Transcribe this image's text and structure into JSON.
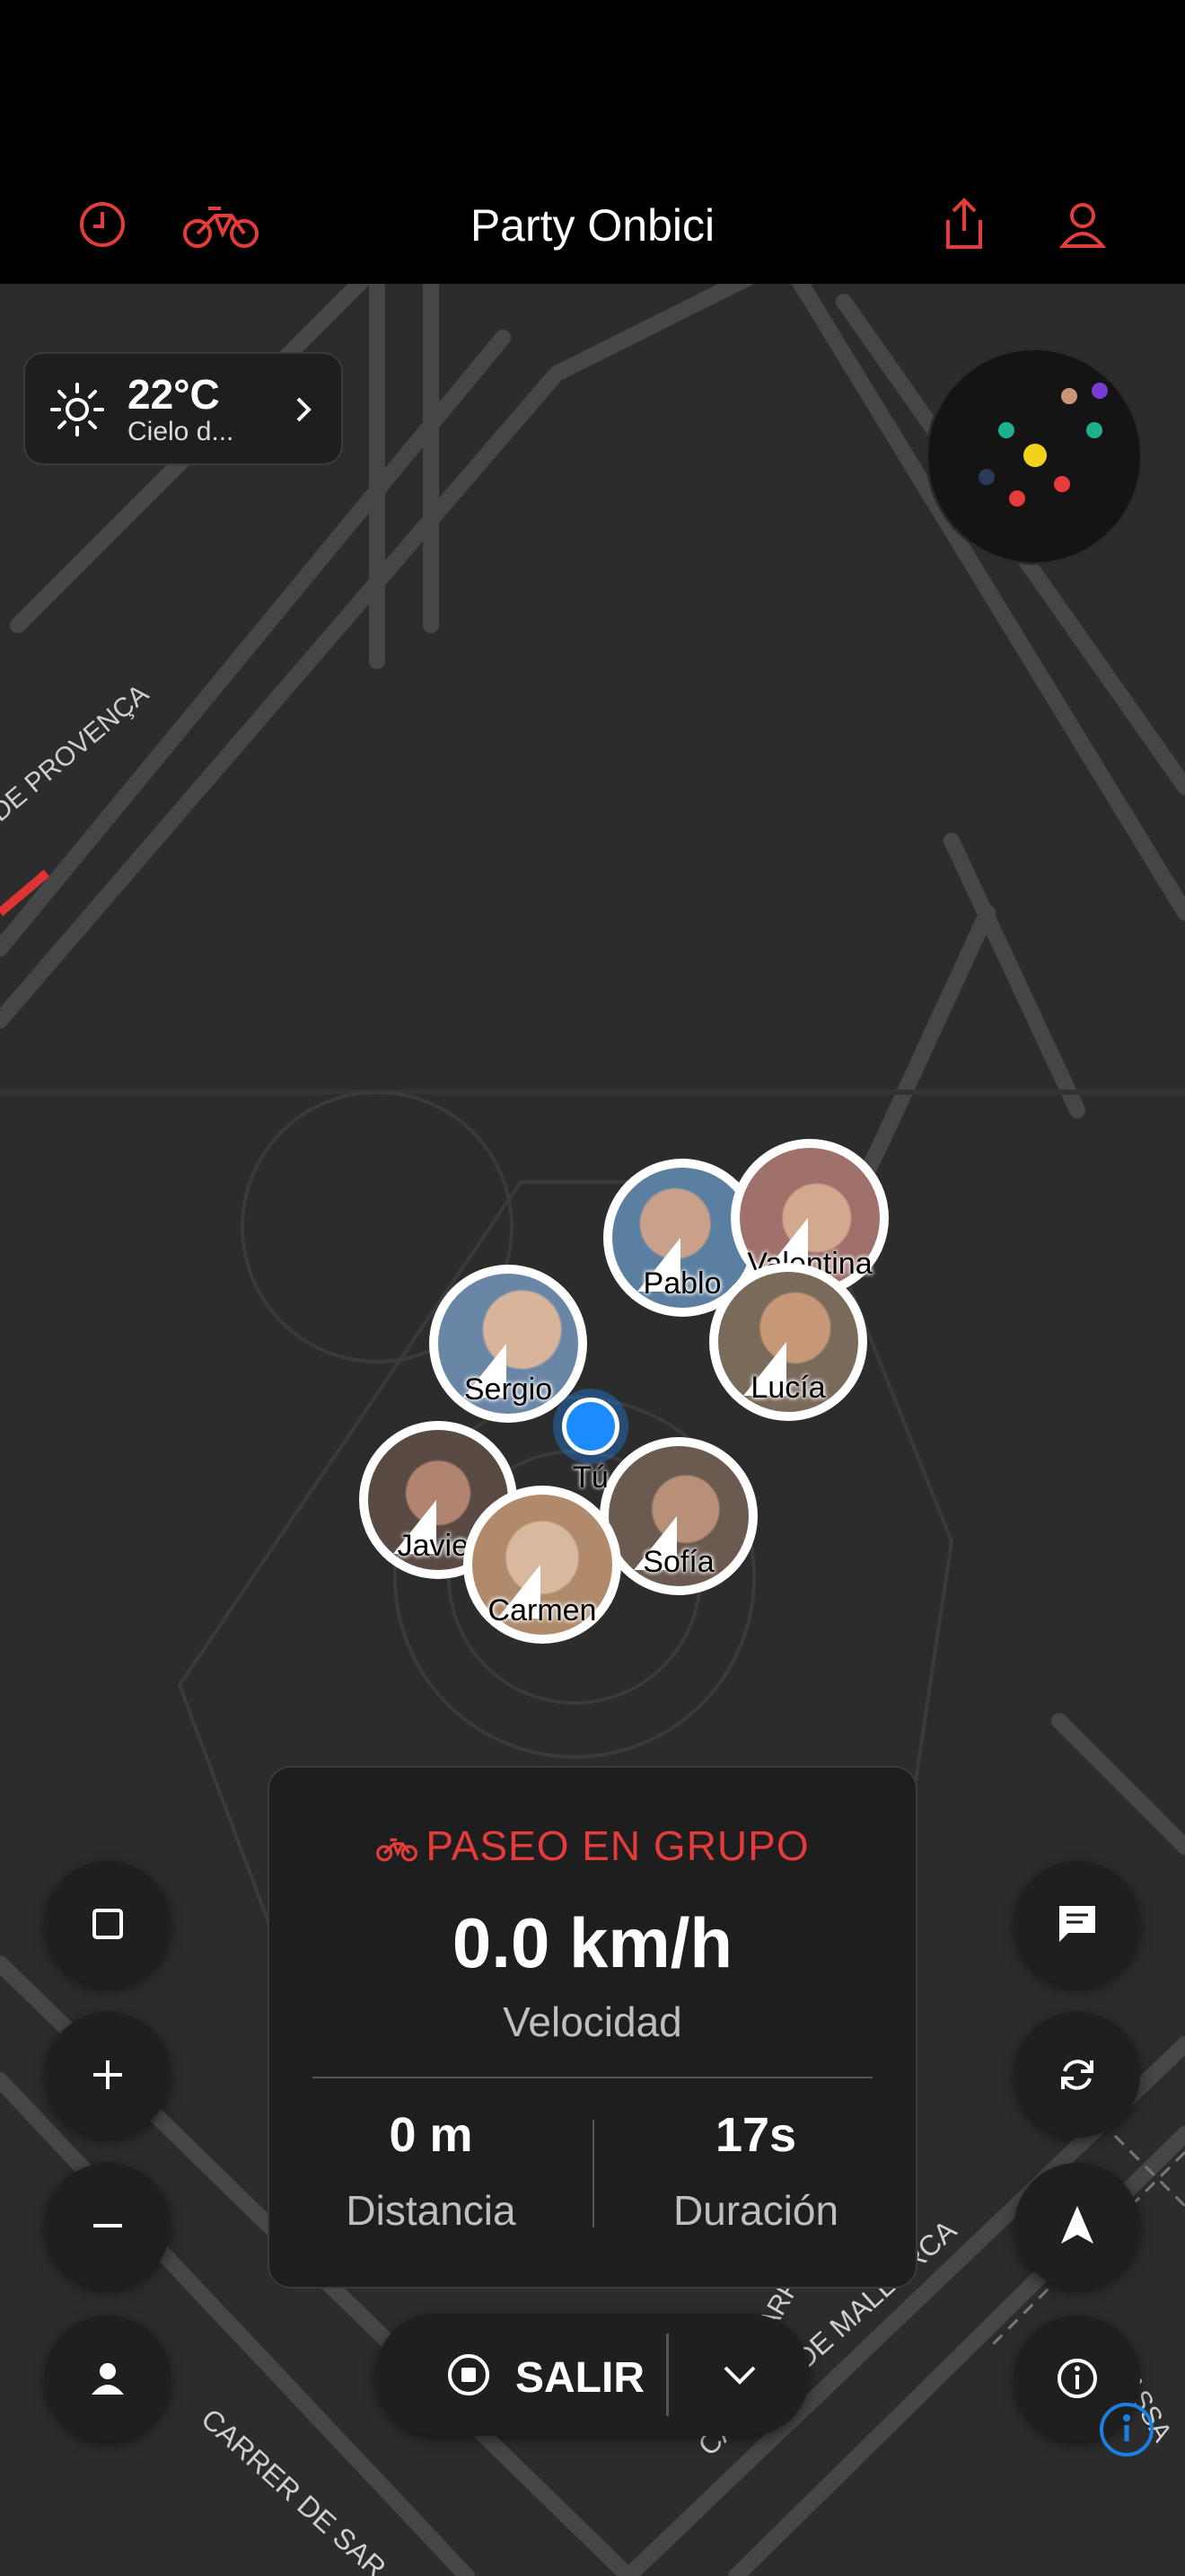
{
  "header": {
    "title": "Party Onbici",
    "icons": [
      "history-icon",
      "bike-icon",
      "share-icon",
      "profile-icon"
    ],
    "accent": "#e43b3b"
  },
  "weather": {
    "temp": "22°C",
    "desc": "Cielo d..."
  },
  "map": {
    "streets": [
      "DE PROVENÇA",
      "CARRER DE MALLORCA",
      "CARRER DE SAR",
      "CARRER",
      "PASSA"
    ]
  },
  "riders": [
    {
      "name": "Pablo",
      "color": "#5a7fa0"
    },
    {
      "name": "Valentina",
      "color": "#a0706a"
    },
    {
      "name": "Lucía",
      "color": "#7a6a5a"
    },
    {
      "name": "Sergio",
      "color": "#6a86a6"
    },
    {
      "name": "Javier",
      "color": "#5a4a44"
    },
    {
      "name": "Carmen",
      "color": "#b08a6a"
    },
    {
      "name": "Sofía",
      "color": "#6a5a50"
    }
  ],
  "you": {
    "label": "Tú"
  },
  "panel": {
    "heading": "PASEO EN GRUPO",
    "speed": "0.0 km/h",
    "speed_label": "Velocidad",
    "distance": "0 m",
    "distance_label": "Distancia",
    "duration": "17s",
    "duration_label": "Duración"
  },
  "exit": {
    "label": "SALIR"
  }
}
